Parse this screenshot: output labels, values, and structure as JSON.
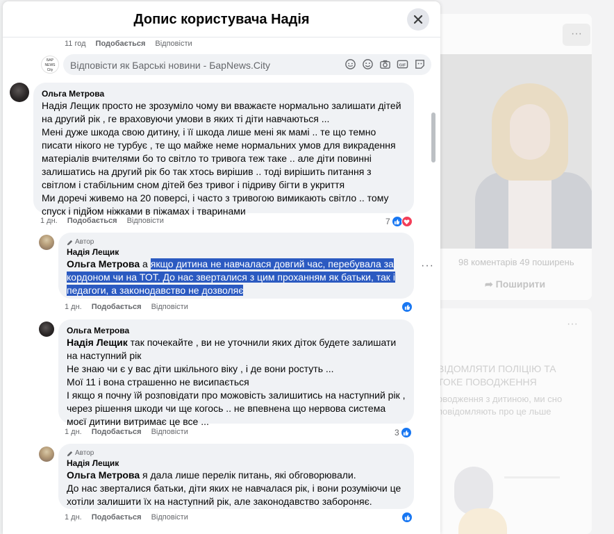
{
  "background": {
    "stats": "98 коментарів   49 поширень",
    "share_label": "Поширити",
    "card_heading": "ВІДОМЛЯТИ ПОЛІЦІЮ ТА ТОКЕ ПОВОДЖЕННЯ",
    "card_text": "оводження з дитиною, ми сно повідомляють про це льше"
  },
  "modal": {
    "title": "Допис користувача Надія"
  },
  "top_meta": {
    "time": "11 год",
    "like": "Подобається",
    "reply": "Відповісти"
  },
  "reply_box": {
    "placeholder": "Відповісти як Барські новини - БарNews.City",
    "logo_text": "БАР NEWS City"
  },
  "comments": [
    {
      "author": "Ольга Метрова",
      "text": "Надія Лещик просто не зрозуміло чому ви вважаєте нормально залишати дітей на другий рік , ге враховуючи умови в яких ті діти навчаються ...\nМені дуже шкода свою дитину, і її шкода лише мені як мамі .. те що темно писати нікого не турбує , те що майже неме нормальних умов для викрадення матеріалів вчителями бо то світло то тривога теж таке .. але діти повинні залишатись на другий рік бо так хтось вирішив .. тоді вирішить питання з світлом і стабільним сном дітей без тривог і підриву бігти в укриття\nМи доречі живемо на 20 поверсі, і часто з тривогою вимикають світло .. тому спуск і підйом ніжками в піжамах і тваринами",
      "time": "1 дн.",
      "like": "Подобається",
      "reply": "Відповісти",
      "reaction_count": "7"
    },
    {
      "author_tag": "Автор",
      "author": "Надія Лещик",
      "mention": "Ольга Метрова",
      "text_plain": " а ",
      "text_highlighted": "якщо дитина не навчалася довгий час, перебувала за кордоном чи на ТОТ. До нас зверталися з цим проханням як батьки, так і педагоги, а законодавство не дозволяє",
      "time": "1 дн.",
      "like": "Подобається",
      "reply": "Відповісти"
    },
    {
      "author": "Ольга Метрова",
      "mention": "Надія Лещик",
      "text": " так почекайте , ви не уточнили яких діток будете залишати на наступний рік\nНе знаю чи є у вас діти шкільного віку , і де вони ростуть ...\nМої 11 і вона страшенно не висипається\nІ якщо я почну їй розповідати про можовість залишитись на наступний рік , через рішення шкоди чи ще когось .. не впевнена що нервова система моєї дитини витримає це все ...",
      "time": "1 дн.",
      "like": "Подобається",
      "reply": "Відповісти",
      "reaction_count": "3"
    },
    {
      "author_tag": "Автор",
      "author": "Надія Лещик",
      "mention": "Ольга Метрова",
      "text": " я дала лише перелік питань, які обговорювали.\nДо нас зверталися батьки, діти яких не навчалася рік, і вони розуміючи це хотіли залишити їх на наступний рік, але законодавство забороняє.",
      "time": "1 дн.",
      "like": "Подобається",
      "reply": "Відповісти"
    }
  ],
  "colors": {
    "like_blue": "#1877f2",
    "love_red": "#f33e58",
    "highlight": "#2b5ac1",
    "bubble_bg": "#f0f2f5"
  },
  "icons": [
    "close-icon",
    "sticker-icon",
    "emoji-icon",
    "camera-icon",
    "gif-icon",
    "avatar-sticker-icon",
    "like-icon",
    "love-icon",
    "pencil-icon",
    "more-icon",
    "share-icon"
  ]
}
